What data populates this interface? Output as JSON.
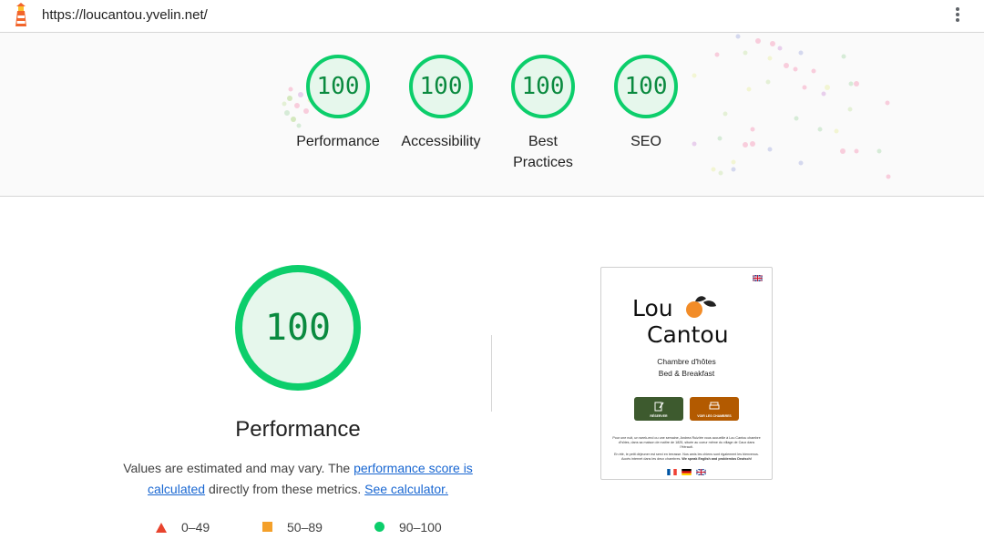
{
  "topbar": {
    "url": "https://loucantou.yvelin.net/"
  },
  "gauges": [
    {
      "score": "100",
      "label_lines": [
        "Performance"
      ]
    },
    {
      "score": "100",
      "label_lines": [
        "Accessibility"
      ]
    },
    {
      "score": "100",
      "label_lines": [
        "Best",
        "Practices"
      ]
    },
    {
      "score": "100",
      "label_lines": [
        "SEO"
      ]
    }
  ],
  "performance": {
    "score": "100",
    "title": "Performance",
    "desc_before": "Values are estimated and may vary. The ",
    "desc_link1": "performance score is calculated",
    "desc_middle": " directly from these metrics. ",
    "desc_link2": "See calculator."
  },
  "legend": [
    {
      "range": "0–49",
      "shape": "triangle",
      "color": "#e8432d"
    },
    {
      "range": "50–89",
      "shape": "square",
      "color": "#f4a02a"
    },
    {
      "range": "90–100",
      "shape": "circle",
      "color": "#0cce6b"
    }
  ],
  "colors": {
    "pass": "#0cce6b",
    "pass_bg": "#e6f7ec",
    "pass_text": "#0a8a3f",
    "link": "#1967d2"
  },
  "screenshot": {
    "brand_line1": "Lou",
    "brand_line2": "Cantou",
    "tagline1": "Chambre d'hôtes",
    "tagline2": "Bed & Breakfast",
    "button_reserve": "RÉSERVER",
    "button_rooms": "VOIR LES CHAMBRES",
    "paragraph1": "Pour une nuit, un week-end ou une semaine, Andrea Ruiz/ée vous accueille à Lou Cantou chambre d'hôtes, dans sa maison de maître de 1825, située au coeur même du village de Caux dans l'Hérault.",
    "paragraph2": "En été, le petit déjeuner est servi en terrasse. Nos amis les chiens sont également les bienvenus. Accès internet dans les deux chambres.",
    "paragraph2_bold": "We speak English and problemlos Deutsch!",
    "icons": [
      "lighthouse-icon",
      "kebab-menu-icon",
      "uk-flag-icon",
      "orange-fruit-icon",
      "french-flag-icon",
      "german-flag-icon"
    ]
  }
}
